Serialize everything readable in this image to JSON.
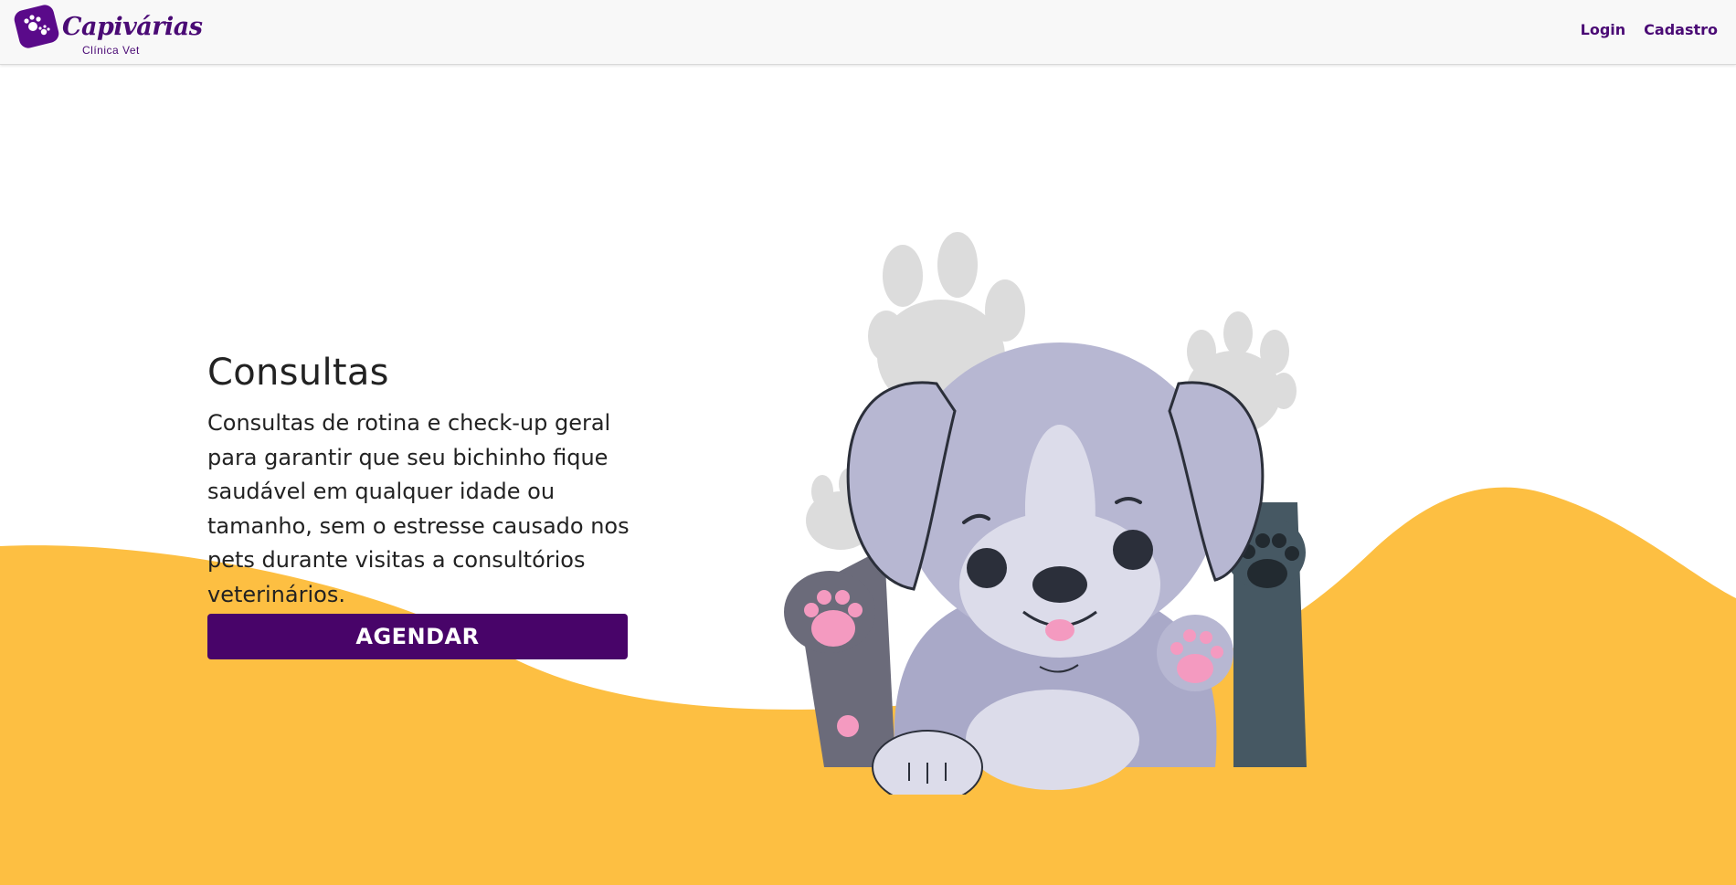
{
  "brand": {
    "name": "Capivárias",
    "subtitle": "Clínica Vet"
  },
  "nav": {
    "links": [
      {
        "label": "Login"
      },
      {
        "label": "Cadastro"
      }
    ]
  },
  "hero": {
    "title": "Consultas",
    "description": "Consultas de rotina e check-up geral para garantir que seu bichinho fique saudável em qualquer idade ou tamanho, sem o estresse causado nos pets durante visitas a consultórios veterinários.",
    "cta_label": "AGENDAR"
  },
  "colors": {
    "primary": "#480469",
    "accent_yellow": "#fdbf42",
    "nav_bg": "#f8f8f8"
  },
  "icons": [
    "paw-logo-icon",
    "puppy-illustration",
    "paw-print-decoration"
  ]
}
